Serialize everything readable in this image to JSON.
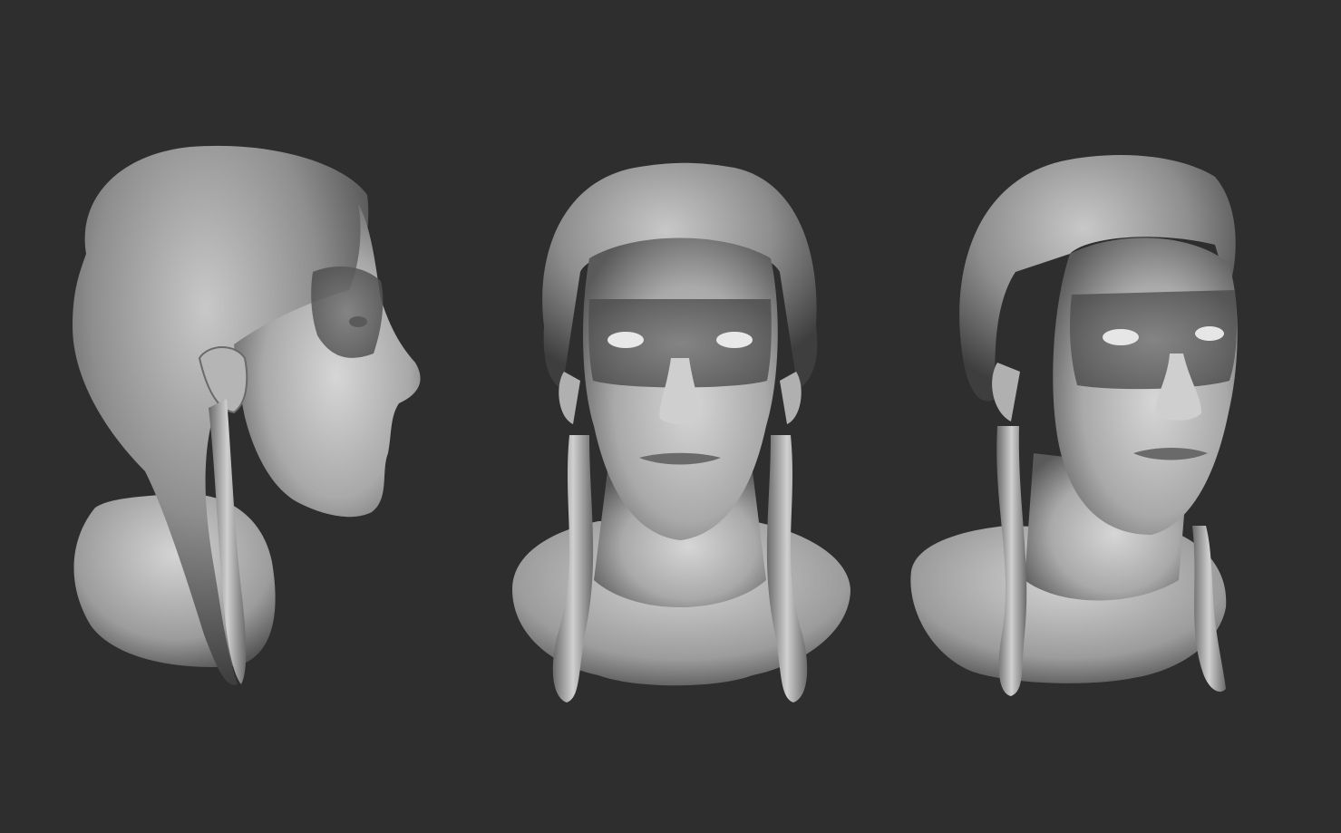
{
  "scene": {
    "background_color": "#2e2e2e",
    "clay_base_color": "#9a9a9a",
    "clay_highlight_color": "#e0e0e0",
    "clay_shadow_color": "#4a4a4a",
    "views": [
      {
        "name": "side-view",
        "orientation": "profile-right"
      },
      {
        "name": "front-view",
        "orientation": "front"
      },
      {
        "name": "three-quarter-view",
        "orientation": "three-quarter-right"
      }
    ]
  }
}
